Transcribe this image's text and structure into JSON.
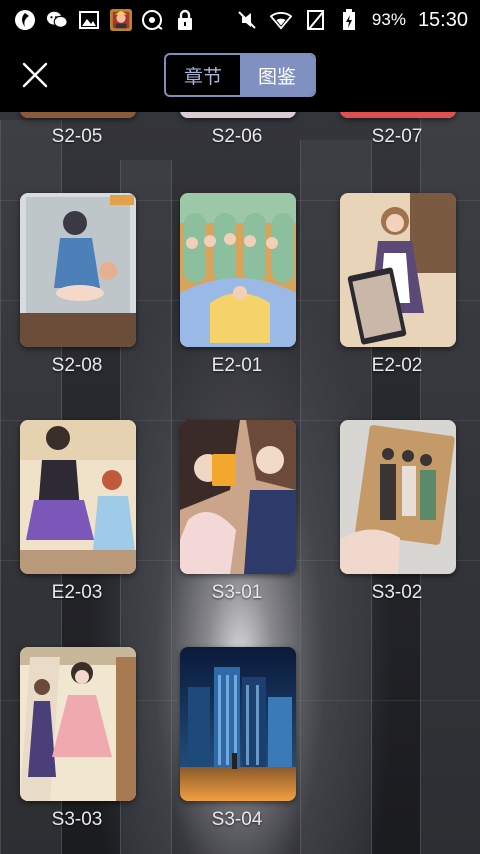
{
  "status_bar": {
    "battery": "93%",
    "time": "15:30",
    "icons_left": [
      "app-icon",
      "wechat-icon",
      "gallery-icon",
      "game-avatar-icon",
      "disc-icon",
      "lock-icon"
    ],
    "icons_right": [
      "mute-icon",
      "wifi-icon",
      "no-sim-icon",
      "battery-icon"
    ]
  },
  "nav": {
    "tabs": [
      {
        "label": "章节",
        "active": false
      },
      {
        "label": "图鉴",
        "active": true
      }
    ]
  },
  "gallery": {
    "items": [
      {
        "label": "S2-05",
        "partial": true
      },
      {
        "label": "S2-06",
        "partial": true
      },
      {
        "label": "S2-07",
        "partial": true
      },
      {
        "label": "S2-08"
      },
      {
        "label": "E2-01"
      },
      {
        "label": "E2-02"
      },
      {
        "label": "E2-03"
      },
      {
        "label": "S3-01"
      },
      {
        "label": "S3-02"
      },
      {
        "label": "S3-03"
      },
      {
        "label": "S3-04"
      }
    ]
  },
  "colors": {
    "accent": "#8090c0",
    "accent_border": "#7f8fbc",
    "tab_inactive_text": "#aab6d8"
  }
}
